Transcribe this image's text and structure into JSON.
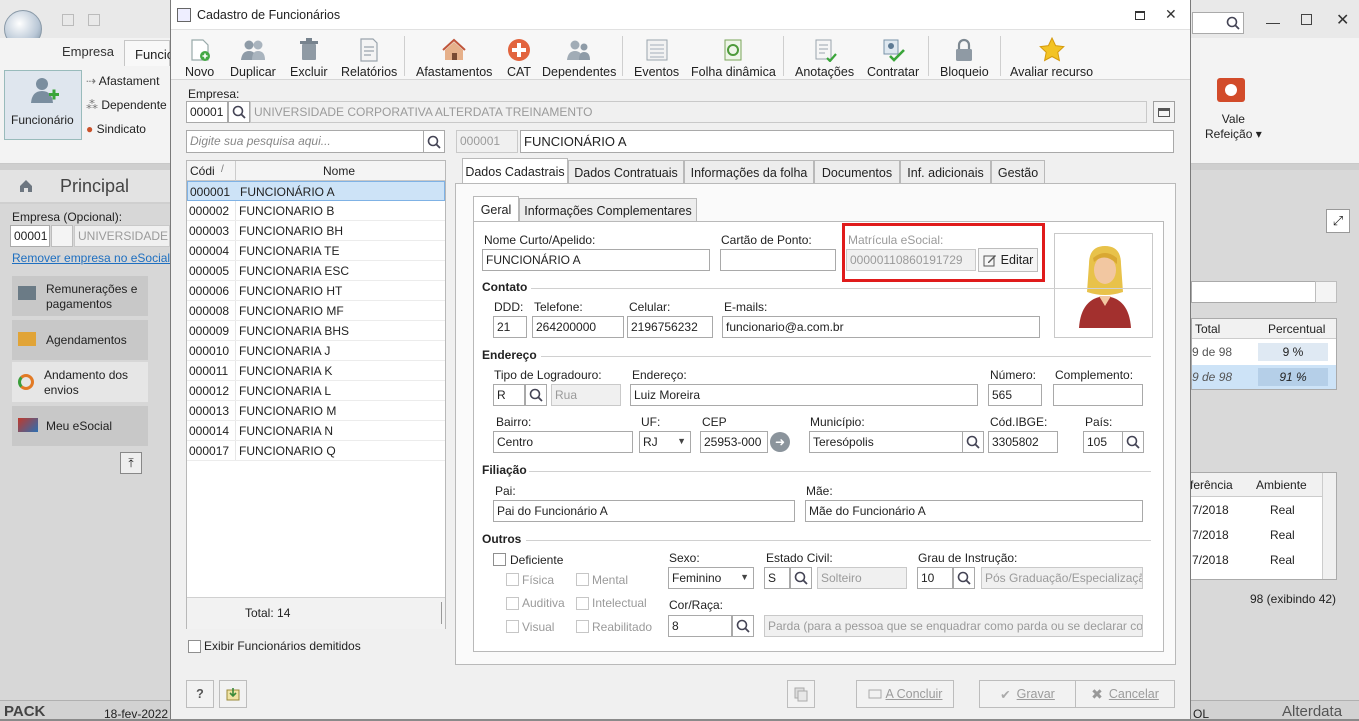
{
  "background": {
    "ribbon_tabs": [
      "Empresa",
      "Funcio"
    ],
    "ribbon_button": "Funcionário",
    "ribbon_items": [
      "Afastament",
      "Dependente",
      "Sindicato"
    ],
    "vale_label": "Vale\nRefeição ▾",
    "principal_tab": "Principal",
    "empresa_label": "Empresa (Opcional):",
    "empresa_code": "00001",
    "empresa_name": "UNIVERSIDADE C",
    "remove_link": "Remover empresa no eSocial",
    "side_menu": [
      "Remunerações e pagamentos",
      "Agendamentos",
      "Andamento dos envios",
      "Meu eSocial"
    ],
    "right_headers": [
      "Total",
      "Percentual"
    ],
    "right_rows": [
      [
        "9 de 98",
        "9 %"
      ],
      [
        "9 de 98",
        "91 %"
      ]
    ],
    "right_headers2": [
      "ferência",
      "Ambiente"
    ],
    "right_rows2": [
      [
        "7/2018",
        "Real"
      ],
      [
        "7/2018",
        "Real"
      ],
      [
        "7/2018",
        "Real"
      ]
    ],
    "right_footer": "98 (exibindo 42)",
    "status_left": "PACK",
    "status_date": "18-fev-2022",
    "status_right": "OL",
    "brand": "Alterdata"
  },
  "dialog": {
    "title": "Cadastro de Funcionários",
    "toolbar": [
      "Novo",
      "Duplicar",
      "Excluir",
      "Relatórios",
      "Afastamentos",
      "CAT",
      "Dependentes",
      "Eventos",
      "Folha dinâmica",
      "Anotações",
      "Contratar",
      "Bloqueio",
      "Avaliar recurso"
    ],
    "empresa_label": "Empresa:",
    "empresa_code": "00001",
    "empresa_name": "UNIVERSIDADE CORPORATIVA ALTERDATA TREINAMENTO",
    "search_placeholder": "Digite sua pesquisa aqui...",
    "current_code": "000001",
    "current_name": "FUNCIONÁRIO A",
    "grid_headers": [
      "Códi",
      "Nome"
    ],
    "employees": [
      [
        "000001",
        "FUNCIONÁRIO A"
      ],
      [
        "000002",
        "FUNCIONARIO B"
      ],
      [
        "000003",
        "FUNCIONARIO BH"
      ],
      [
        "000004",
        "FUNCIONARIA TE"
      ],
      [
        "000005",
        "FUNCIONARIA ESC"
      ],
      [
        "000006",
        "FUNCIONARIO HT"
      ],
      [
        "000008",
        "FUNCIONARIO MF"
      ],
      [
        "000009",
        "FUNCIONARIA BHS"
      ],
      [
        "000010",
        "FUNCIONARIA J"
      ],
      [
        "000011",
        "FUNCIONARIA K"
      ],
      [
        "000012",
        "FUNCIONARIA L"
      ],
      [
        "000013",
        "FUNCIONARIO M"
      ],
      [
        "000014",
        "FUNCIONARIA N"
      ],
      [
        "000017",
        "FUNCIONARIO Q"
      ]
    ],
    "total": "Total: 14",
    "show_dismissed": "Exibir Funcionários demitidos",
    "main_tabs": [
      "Dados Cadastrais",
      "Dados Contratuais",
      "Informações da folha",
      "Documentos",
      "Inf. adicionais",
      "Gestão"
    ],
    "sub_tabs": [
      "Geral",
      "Informações Complementares"
    ],
    "form": {
      "nome_label": "Nome Curto/Apelido:",
      "nome": "FUNCIONÁRIO A",
      "cartao_label": "Cartão de Ponto:",
      "cartao": "",
      "matricula_label": "Matrícula eSocial:",
      "matricula": "00000110860191729",
      "editar": "Editar",
      "contato": "Contato",
      "ddd_label": "DDD:",
      "ddd": "21",
      "tel_label": "Telefone:",
      "tel": "264200000",
      "cel_label": "Celular:",
      "cel": "2196756232",
      "email_label": "E-mails:",
      "email": "funcionario@a.com.br",
      "endereco": "Endereço",
      "tipo_label": "Tipo de Logradouro:",
      "tipo": "R",
      "tipo_desc": "Rua",
      "end_label": "Endereço:",
      "end": "Luiz Moreira",
      "num_label": "Número:",
      "num": "565",
      "comp_label": "Complemento:",
      "comp": "",
      "bairro_label": "Bairro:",
      "bairro": "Centro",
      "uf_label": "UF:",
      "uf": "RJ",
      "cep_label": "CEP",
      "cep": "25953-000",
      "mun_label": "Município:",
      "mun": "Teresópolis",
      "ibge_label": "Cód.IBGE:",
      "ibge": "3305802",
      "pais_label": "País:",
      "pais": "105",
      "filiacao": "Filiação",
      "pai_label": "Pai:",
      "pai": "Pai do Funcionário A",
      "mae_label": "Mãe:",
      "mae": "Mãe do Funcionário A",
      "outros": "Outros",
      "deficiente": "Deficiente",
      "defs": [
        "Física",
        "Mental",
        "Auditiva",
        "Intelectual",
        "Visual",
        "Reabilitado"
      ],
      "sexo_label": "Sexo:",
      "sexo": "Feminino",
      "civil_label": "Estado Civil:",
      "civil": "S",
      "civil_desc": "Solteiro",
      "grau_label": "Grau de Instrução:",
      "grau": "10",
      "grau_desc": "Pós Graduação/Especialização",
      "cor_label": "Cor/Raça:",
      "cor": "8",
      "cor_desc": "Parda (para a pessoa que se enquadrar como parda ou se declarar com"
    },
    "footer": {
      "concluir": "A Concluir",
      "gravar": "Gravar",
      "cancelar": "Cancelar"
    }
  },
  "colors": {
    "highlight_border": "#e01b1b",
    "selection": "#cde3f7",
    "accent": "#1e6fc0"
  }
}
